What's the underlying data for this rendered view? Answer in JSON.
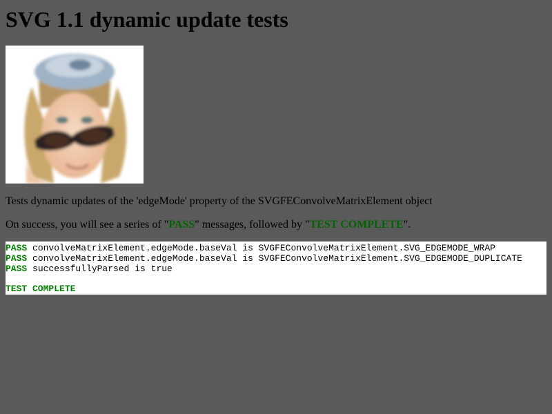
{
  "page": {
    "title": "SVG 1.1 dynamic update tests",
    "description": "Tests dynamic updates of the 'edgeMode' property of the SVGFEConvolveMatrixElement object",
    "success_prefix": "On success, you will see a series of \"",
    "success_pass": "PASS",
    "success_middle": "\" messages, followed by \"",
    "success_complete": "TEST COMPLETE",
    "success_suffix": "\"."
  },
  "console": {
    "lines": [
      {
        "status": "PASS",
        "text": " convolveMatrixElement.edgeMode.baseVal is SVGFEConvolveMatrixElement.SVG_EDGEMODE_WRAP"
      },
      {
        "status": "PASS",
        "text": " convolveMatrixElement.edgeMode.baseVal is SVGFEConvolveMatrixElement.SVG_EDGEMODE_DUPLICATE"
      },
      {
        "status": "PASS",
        "text": " successfullyParsed is true"
      }
    ],
    "complete": "TEST COMPLETE"
  },
  "colors": {
    "background": "#5a5a5a",
    "pass_green": "#008000"
  },
  "image": {
    "icon": "portrait-photo-woman-sunglasses"
  }
}
